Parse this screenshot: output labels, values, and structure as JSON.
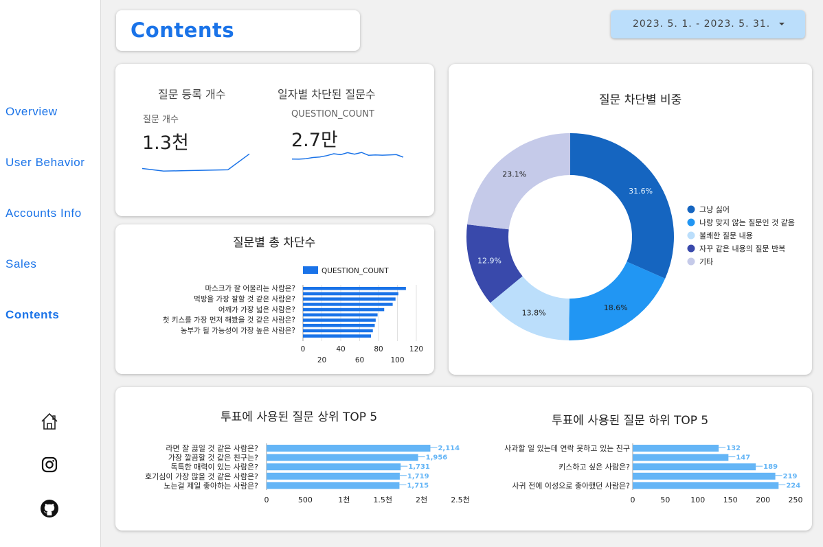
{
  "sidebar": {
    "items": [
      {
        "label": "Overview"
      },
      {
        "label": "User Behavior"
      },
      {
        "label": "Accounts Info"
      },
      {
        "label": "Sales"
      },
      {
        "label": "Contents"
      }
    ],
    "active": "Contents",
    "icons": [
      "home-icon",
      "instagram-icon",
      "github-icon"
    ]
  },
  "header": {
    "title": "Contents",
    "date_range": "2023. 5. 1. - 2023. 5. 31."
  },
  "kpi": {
    "questions": {
      "title": "질문 등록 개수",
      "label": "질문 개수",
      "value": "1.3천"
    },
    "blocked": {
      "title": "일자별 차단된 질문수",
      "label": "QUESTION_COUNT",
      "value": "2.7만"
    }
  },
  "colors": {
    "accent": "#1a73e8",
    "bar_primary": "#1a73e8",
    "bar_light": "#64b5f6",
    "pie": [
      "#1565c0",
      "#2196f3",
      "#bbdefb",
      "#3949ab",
      "#c5cae9"
    ]
  },
  "chart_data": [
    {
      "type": "line",
      "title": "질문 등록 개수",
      "label": "질문 개수",
      "values": [
        120,
        60,
        70,
        80,
        90,
        460
      ]
    },
    {
      "type": "line",
      "title": "일자별 차단된 질문수",
      "label": "QUESTION_COUNT",
      "values": [
        820,
        810,
        860,
        980,
        1040,
        1180,
        1380,
        1290,
        1500,
        1340,
        1520,
        1220,
        1260,
        1230,
        1250,
        1290,
        1020
      ]
    },
    {
      "type": "bar",
      "orientation": "horizontal",
      "title": "질문별 총 차단수",
      "legend": "QUESTION_COUNT",
      "categories": [
        "마스크가 잘 어울리는 사람은?",
        "",
        "먹방을 가장 잘할 것 같은 사람은?",
        "",
        "어깨가 가장 넓은 사람은?",
        "",
        "첫 키스를 가장 먼저 해봤을 것 같은 사람은?",
        "",
        "농부가 될 가능성이 가장 높은 사람은?",
        ""
      ],
      "values": [
        109,
        101,
        98,
        95,
        86,
        79,
        77,
        76,
        74,
        72
      ],
      "xlim": [
        0,
        120
      ],
      "xticks_top": [
        "0",
        "40",
        "80",
        "120"
      ],
      "xticks_bottom": [
        "20",
        "60",
        "100"
      ]
    },
    {
      "type": "pie",
      "title": "질문 차단별 비중",
      "labels": [
        "그냥 싫어",
        "나랑 맞지 않는 질문인 것 같음",
        "불쾌한 질문 내용",
        "자꾸 같은 내용의 질문 반복",
        "기타"
      ],
      "values": [
        31.6,
        18.6,
        13.8,
        12.9,
        23.1
      ],
      "value_labels": [
        "31.6%",
        "18.6%",
        "13.8%",
        "12.9%",
        "23.1%"
      ],
      "legend_position": "right"
    },
    {
      "type": "bar",
      "orientation": "horizontal",
      "title": "투표에 사용된 질문 상위 TOP 5",
      "categories": [
        "라면 잘 끓일 것 같은 사람은?",
        "가장 깔끔할 것 같은 친구는?",
        "독특한 매력이 있는 사람은?",
        "호기심이 가장 많을 것 같은 사람은?",
        "노는걸 제일 좋아하는 사람은?"
      ],
      "values": [
        2114,
        1956,
        1731,
        1719,
        1715
      ],
      "value_labels": [
        "2,114",
        "1,956",
        "1,731",
        "1,719",
        "1,715"
      ],
      "xlim": [
        0,
        2500
      ],
      "xticks": [
        "0",
        "500",
        "1천",
        "1.5천",
        "2천",
        "2.5천"
      ]
    },
    {
      "type": "bar",
      "orientation": "horizontal",
      "title": "투표에 사용된 질문 하위 TOP 5",
      "categories": [
        "사과할 일 있는데 연락 못하고 있는 친구",
        "",
        "키스하고 싶은 사람은?",
        "",
        "사귀 전에 이성으로 좋아했던 사람은?"
      ],
      "values": [
        132,
        147,
        189,
        219,
        224
      ],
      "value_labels": [
        "132",
        "147",
        "189",
        "219",
        "224"
      ],
      "xlim": [
        0,
        250
      ],
      "xticks": [
        "0",
        "50",
        "100",
        "150",
        "200",
        "250"
      ]
    }
  ]
}
